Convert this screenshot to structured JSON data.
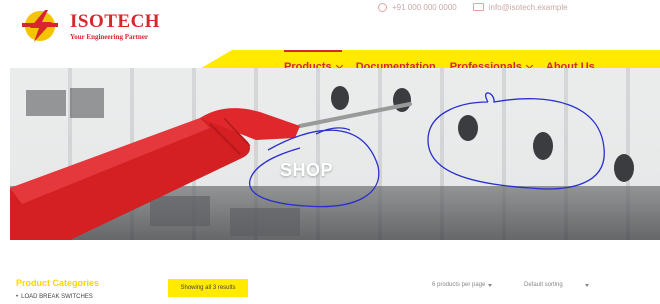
{
  "header": {
    "brand_name": "ISOTECH",
    "brand_tagline": "Your Engineering Partner",
    "phone": "+91 000 000 0000",
    "email": "info@isotech.example"
  },
  "nav": {
    "items": [
      {
        "label": "Products",
        "has_dropdown": true,
        "active": true
      },
      {
        "label": "Documentation",
        "has_dropdown": false,
        "active": false
      },
      {
        "label": "Professionals",
        "has_dropdown": true,
        "active": false
      },
      {
        "label": "About Us",
        "has_dropdown": false,
        "active": false
      }
    ]
  },
  "hero": {
    "title": "SHOP"
  },
  "sidebar": {
    "title": "Product Categories",
    "categories": [
      "LOAD BREAK SWITCHES"
    ]
  },
  "shop": {
    "results_text": "Showing all 3 results",
    "per_page": "6 products per page",
    "sorting": "Default sorting"
  },
  "colors": {
    "brand_red": "#d8262d",
    "nav_yellow": "#ffea00",
    "category_title": "#ffd500",
    "annotation_blue": "#2a2fd0"
  }
}
